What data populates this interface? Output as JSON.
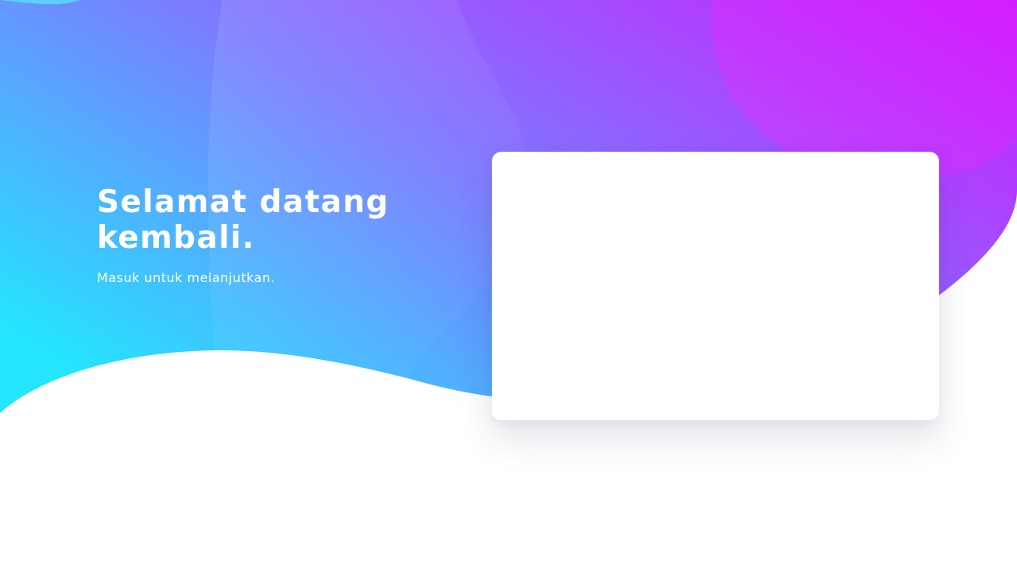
{
  "hero": {
    "title": "Selamat datang kembali.",
    "subtitle": "Masuk untuk melanjutkan."
  },
  "colors": {
    "gradient_start": "#24e4fe",
    "gradient_mid": "#7b73ff",
    "gradient_end": "#c822ff",
    "card_background": "#ffffff",
    "page_background": "#ffffff"
  }
}
